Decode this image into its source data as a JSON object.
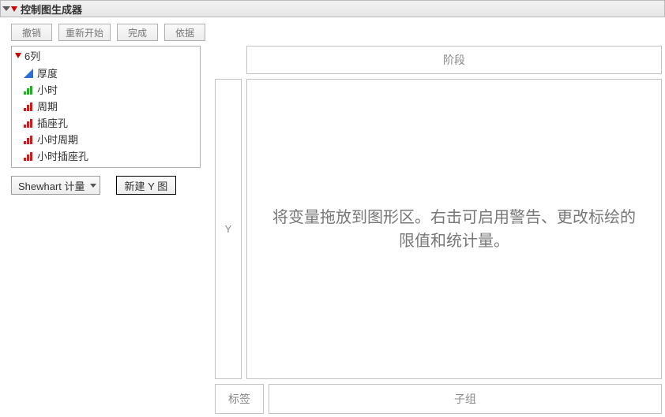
{
  "title": "控制图生成器",
  "toolbar": {
    "undo": "撤销",
    "restart": "重新开始",
    "done": "完成",
    "basis": "依据"
  },
  "columns": {
    "header": "6列",
    "items": [
      {
        "label": "厚度",
        "icon": "continuous-blue"
      },
      {
        "label": "小时",
        "icon": "nominal-green"
      },
      {
        "label": "周期",
        "icon": "ordinal-red"
      },
      {
        "label": "插座孔",
        "icon": "ordinal-red"
      },
      {
        "label": "小时周期",
        "icon": "ordinal-red"
      },
      {
        "label": "小时插座孔",
        "icon": "ordinal-red"
      }
    ]
  },
  "controls": {
    "chart_type": "Shewhart 计量",
    "new_y_chart": "新建 Y 图"
  },
  "zones": {
    "phase": "阶段",
    "y": "Y",
    "canvas_hint": "将变量拖放到图形区。右击可启用警告、更改标绘的限值和统计量。",
    "label": "标签",
    "subgroup": "子组"
  }
}
